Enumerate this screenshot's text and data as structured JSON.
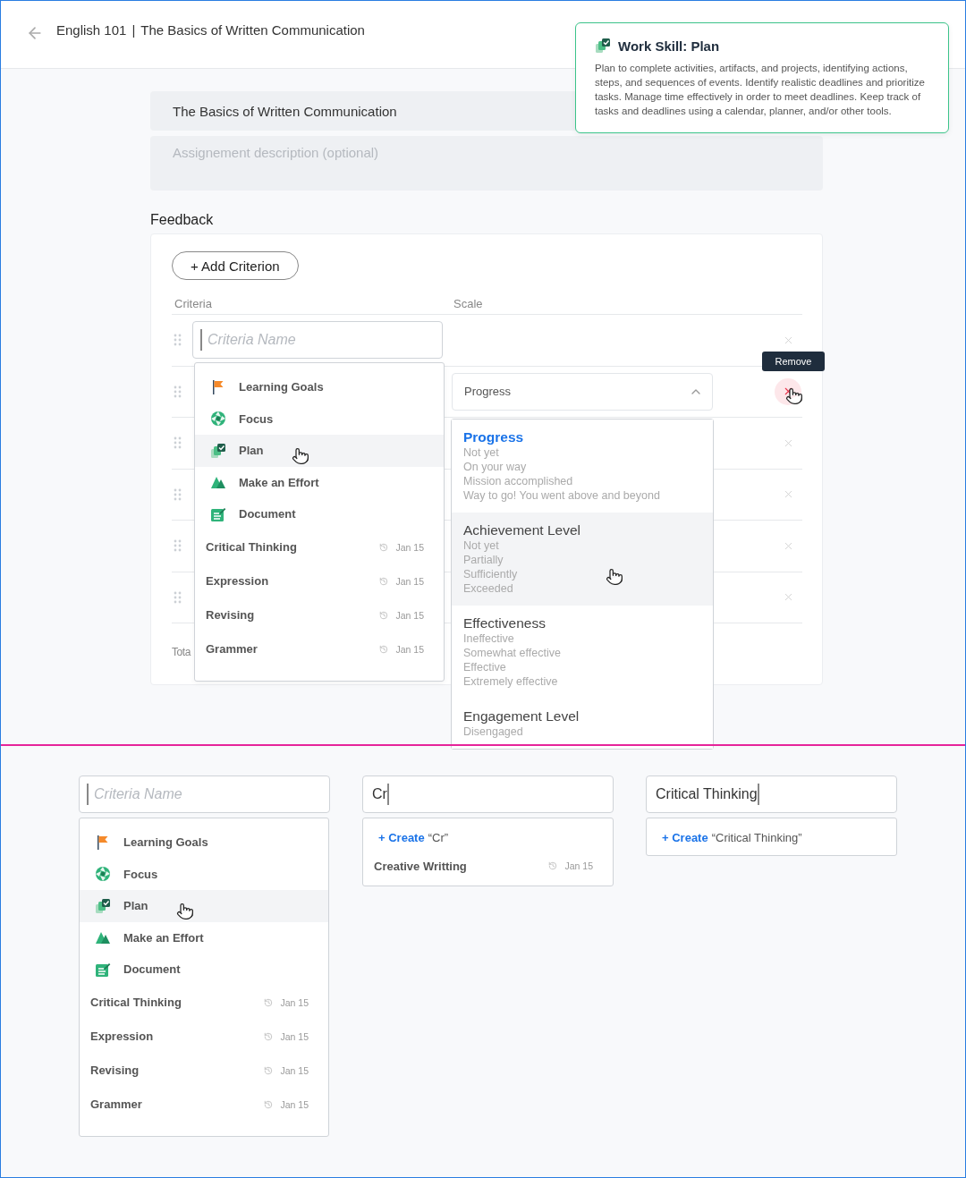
{
  "header": {
    "course": "English 101",
    "separator": "|",
    "title": "The Basics of Written Communication"
  },
  "skill_tooltip": {
    "title": "Work Skill: Plan",
    "description": "Plan to complete activities, artifacts, and projects, identifying actions, steps, and sequences of events. Identify realistic deadlines and prioritize tasks. Manage time effectively in order to meet deadlines. Keep track of tasks and deadlines using a calendar, planner, and/or other tools."
  },
  "assignment": {
    "title_value": "The Basics of Written Communication",
    "description_placeholder": "Assignement description (optional)"
  },
  "feedback": {
    "heading": "Feedback",
    "add_button": "+ Add Criterion",
    "columns": [
      "Criteria",
      "Scale"
    ],
    "rows": [
      {
        "kind": "input",
        "placeholder": "Criteria Name",
        "remove_hovered": false
      },
      {
        "kind": "select",
        "scale_value": "Progress",
        "expanded": true,
        "remove_hovered": true
      },
      {
        "kind": "empty",
        "remove_hovered": false
      },
      {
        "kind": "empty",
        "remove_hovered": false
      },
      {
        "kind": "empty",
        "remove_hovered": false
      },
      {
        "kind": "empty",
        "remove_hovered": false
      }
    ],
    "total_label": "Tota",
    "remove_tooltip": "Remove",
    "criteria_menu": {
      "skills": [
        {
          "label": "Learning Goals",
          "kind": "flag",
          "highlighted": false
        },
        {
          "label": "Focus",
          "kind": "aperture",
          "highlighted": false
        },
        {
          "label": "Plan",
          "kind": "stack",
          "highlighted": true
        },
        {
          "label": "Make an Effort",
          "kind": "mountain",
          "highlighted": false
        },
        {
          "label": "Document",
          "kind": "notepad",
          "highlighted": false
        }
      ],
      "recent": [
        {
          "label": "Critical Thinking",
          "date": "Jan 15"
        },
        {
          "label": "Expression",
          "date": "Jan 15"
        },
        {
          "label": "Revising",
          "date": "Jan 15"
        },
        {
          "label": "Grammer",
          "date": "Jan 15"
        }
      ]
    },
    "scale_menu": [
      {
        "name": "Progress",
        "selected": true,
        "hovered": false,
        "options": [
          "Not yet",
          "On your way",
          "Mission accomplished",
          "Way to go! You went above and beyond"
        ]
      },
      {
        "name": "Achievement Level",
        "selected": false,
        "hovered": true,
        "options": [
          "Not yet",
          "Partially",
          "Sufficiently",
          "Exceeded"
        ]
      },
      {
        "name": "Effectiveness",
        "selected": false,
        "hovered": false,
        "options": [
          "Ineffective",
          "Somewhat effective",
          "Effective",
          "Extremely effective"
        ]
      },
      {
        "name": "Engagement Level",
        "selected": false,
        "hovered": false,
        "options": [
          "Disengaged"
        ]
      }
    ]
  },
  "examples": [
    {
      "kind": "menu",
      "placeholder": "Criteria Name",
      "menu": {
        "skills": [
          {
            "label": "Learning Goals",
            "kind": "flag",
            "highlighted": false
          },
          {
            "label": "Focus",
            "kind": "aperture",
            "highlighted": false
          },
          {
            "label": "Plan",
            "kind": "stack",
            "highlighted": true
          },
          {
            "label": "Make an Effort",
            "kind": "mountain",
            "highlighted": false
          },
          {
            "label": "Document",
            "kind": "notepad",
            "highlighted": false
          }
        ],
        "recent": [
          {
            "label": "Critical Thinking",
            "date": "Jan 15"
          },
          {
            "label": "Expression",
            "date": "Jan 15"
          },
          {
            "label": "Revising",
            "date": "Jan 15"
          },
          {
            "label": "Grammer",
            "date": "Jan 15"
          }
        ]
      }
    },
    {
      "kind": "search",
      "value": "Cr",
      "create_label": "+ Create",
      "create_value": "“Cr”",
      "results": [
        {
          "label": "Creative Writting",
          "date": "Jan 15"
        }
      ]
    },
    {
      "kind": "search",
      "value": "Critical Thinking",
      "create_label": "+ Create",
      "create_value": "“Critical Thinking”"
    }
  ]
}
